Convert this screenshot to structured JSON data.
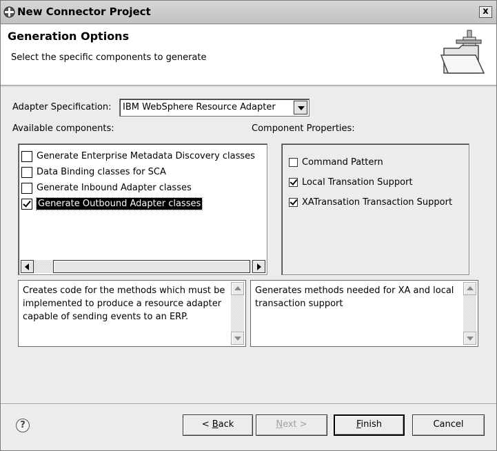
{
  "window": {
    "title": "New Connector Project",
    "close_label": "x"
  },
  "header": {
    "title": "Generation Options",
    "description": "Select the specific components to generate"
  },
  "adapter_spec": {
    "label": "Adapter Specification:",
    "selected": "IBM WebSphere Resource Adapter"
  },
  "available_components": {
    "label": "Available components:",
    "items": [
      {
        "label": "Generate Enterprise Metadata Discovery classes",
        "checked": false,
        "selected": false
      },
      {
        "label": "Data Binding classes for SCA",
        "checked": false,
        "selected": false
      },
      {
        "label": "Generate Inbound Adapter classes",
        "checked": false,
        "selected": false
      },
      {
        "label": "Generate Outbound Adapter classes",
        "checked": true,
        "selected": true
      }
    ],
    "description": "Creates code for the methods which must be implemented to produce a resource adapter capable of sending events to an ERP."
  },
  "component_properties": {
    "label": "Component Properties:",
    "items": [
      {
        "label": "Command Pattern",
        "checked": false
      },
      {
        "label": "Local Transation Support",
        "checked": true
      },
      {
        "label": "XATransation Transaction Support",
        "checked": true
      }
    ],
    "description": "Generates methods needed for XA and local transaction support"
  },
  "footer": {
    "help_label": "?",
    "back": {
      "prefix": "< ",
      "mnemonic": "B",
      "rest": "ack"
    },
    "next": {
      "mnemonic": "N",
      "rest": "ext >"
    },
    "finish": {
      "mnemonic": "F",
      "rest": "inish"
    },
    "cancel": "Cancel"
  }
}
